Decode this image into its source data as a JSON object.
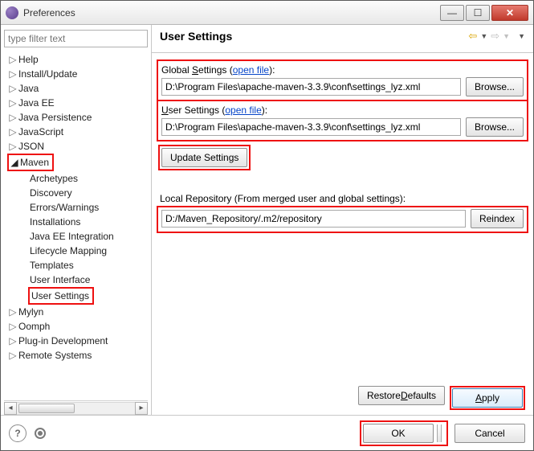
{
  "window": {
    "title": "Preferences"
  },
  "filter_placeholder": "type filter text",
  "tree": {
    "help": "Help",
    "install": "Install/Update",
    "java": "Java",
    "javaee": "Java EE",
    "javapersist": "Java Persistence",
    "javascript": "JavaScript",
    "json": "JSON",
    "maven": "Maven",
    "archetypes": "Archetypes",
    "discovery": "Discovery",
    "errors": "Errors/Warnings",
    "installations": "Installations",
    "javaeeint": "Java EE Integration",
    "lifecycle": "Lifecycle Mapping",
    "templates": "Templates",
    "ui": "User Interface",
    "usersettings": "User Settings",
    "mylyn": "Mylyn",
    "oomph": "Oomph",
    "plugin": "Plug-in Development",
    "remote": "Remote Systems"
  },
  "page": {
    "title": "User Settings",
    "global_label_pre": "Global ",
    "global_label_u": "S",
    "global_label_post": "ettings (",
    "open_file": "open file",
    "label_close": "):",
    "global_value": "D:\\Program Files\\apache-maven-3.3.9\\conf\\settings_lyz.xml",
    "browse": "Browse...",
    "user_label_pre": "",
    "user_label_u": "U",
    "user_label_post": "ser Settings (",
    "user_value": "D:\\Program Files\\apache-maven-3.3.9\\conf\\settings_lyz.xml",
    "update_btn": "Update Settings",
    "local_label": "Local Repository (From merged user and global settings):",
    "local_value": "D:/Maven_Repository/.m2/repository",
    "reindex": "Reindex",
    "restore": "Restore ",
    "restore_u": "D",
    "restore_post": "efaults",
    "apply": "Apply"
  },
  "footer": {
    "ok": "OK",
    "cancel": "Cancel"
  }
}
